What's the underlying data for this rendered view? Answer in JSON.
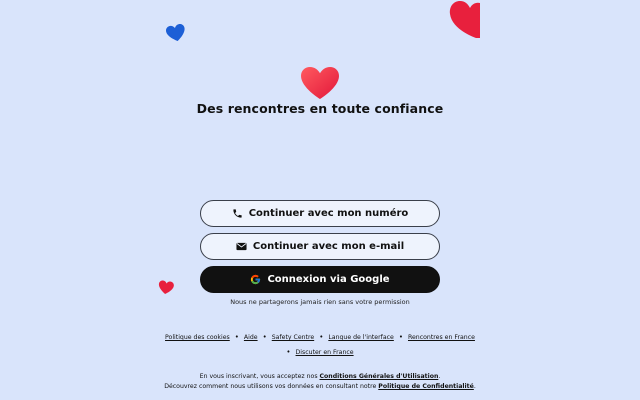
{
  "header": {
    "tagline": "Des rencontres en toute confiance"
  },
  "buttons": {
    "phone": {
      "label": "Continuer avec mon numéro",
      "icon": "phone-icon"
    },
    "email": {
      "label": "Continuer avec mon e-mail",
      "icon": "envelope-icon"
    },
    "google": {
      "label": "Connexion via Google",
      "icon": "google-icon"
    }
  },
  "privacy_note": "Nous ne partagerons jamais rien sans votre permission",
  "footer": {
    "links": [
      "Politique des cookies",
      "Aide",
      "Safety Centre",
      "Langue de l'interface",
      "Rencontres en France",
      "Discuter en France"
    ]
  },
  "legal": {
    "line1_prefix": "En vous inscrivant, vous acceptez nos ",
    "terms_link": "Conditions Générales d'Utilisation",
    "line1_suffix": ".",
    "line2_prefix": "Découvrez comment nous utilisons vos données en consultant notre ",
    "privacy_link": "Politique de Confidentialité",
    "line2_suffix": "."
  },
  "colors": {
    "background": "#d9e4fb",
    "heart_red": "#e8203d",
    "heart_blue": "#1d5fd6",
    "button_dark": "#111111"
  }
}
